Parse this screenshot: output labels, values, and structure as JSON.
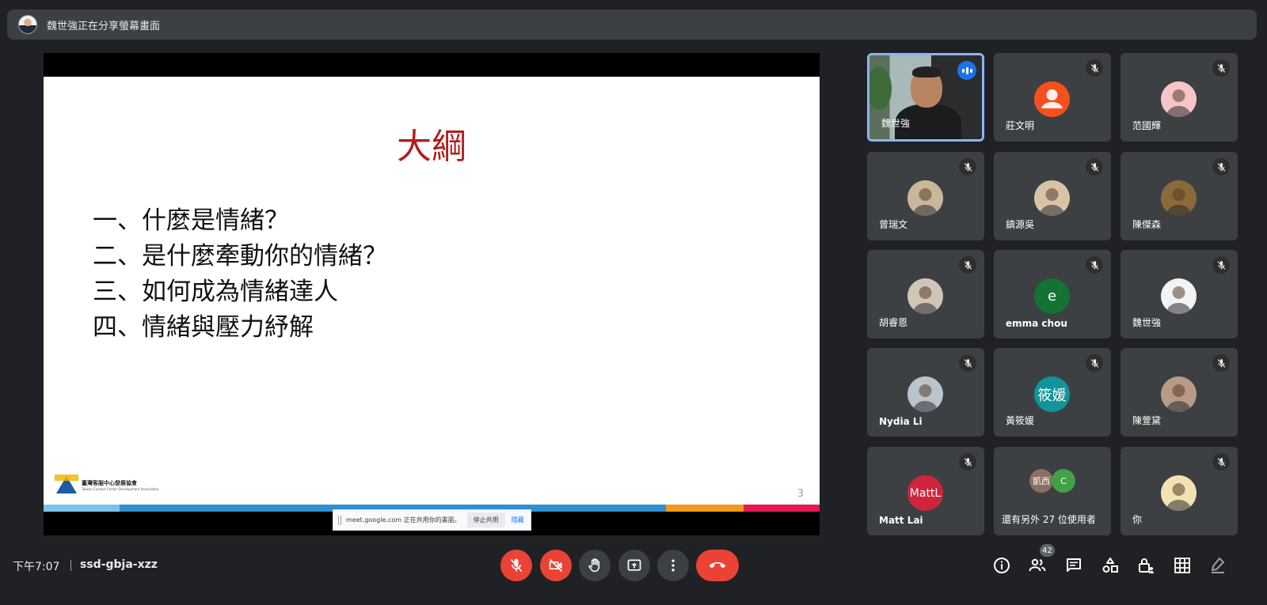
{
  "presenter_bar": {
    "text": "魏世強正在分享螢幕畫面"
  },
  "slide": {
    "title": "大綱",
    "items": [
      "一、什麼是情緒？",
      "二、是什麼牽動你的情緒？",
      "三、如何成為情緒達人",
      "四、情緒與壓力紓解"
    ],
    "logo_text": "臺灣客服中心發展協會",
    "logo_subtext": "Taiwan Contact Center Development Association",
    "page_number": "3",
    "stripe_colors": [
      "#7cc3ea",
      "#2f8fd0",
      "#f29a1c",
      "#e5194f"
    ]
  },
  "share_notice": {
    "text": "meet.google.com 正在共用你的畫面。",
    "stop_label": "停止共用",
    "hide_label": "隱藏"
  },
  "participants": [
    {
      "name": "魏世強",
      "type": "video",
      "speaking": true
    },
    {
      "name": "莊文明",
      "type": "default-avatar",
      "color": "#f4511e"
    },
    {
      "name": "范國輝",
      "type": "photo",
      "color": "#f6c5c9"
    },
    {
      "name": "曾瑞文",
      "type": "photo",
      "color": "#c9b79a"
    },
    {
      "name": "鎮源吳",
      "type": "photo",
      "color": "#d8c3a6"
    },
    {
      "name": "陳傑森",
      "type": "photo",
      "color": "#8a6a3b"
    },
    {
      "name": "胡睿恩",
      "type": "photo",
      "color": "#cfc6b8"
    },
    {
      "name": "emma chou",
      "type": "letter",
      "letter": "e",
      "color": "#137333",
      "bold": true
    },
    {
      "name": "魏世強",
      "type": "photo",
      "color": "#f1f3f4"
    },
    {
      "name": "Nydia Li",
      "type": "photo",
      "color": "#b9c4cc",
      "bold": true
    },
    {
      "name": "黃筱媛",
      "type": "letter",
      "letter": "筱媛",
      "color": "#12939a"
    },
    {
      "name": "陳萱黛",
      "type": "photo",
      "color": "#b79b86"
    },
    {
      "name": "Matt Lai",
      "type": "letter",
      "letter": "MattL",
      "color": "#d0243d",
      "bold": true
    },
    {
      "name": "還有另外 27 位使用者",
      "type": "more",
      "avatars": [
        {
          "label": "凱西",
          "color": "#8d6e63"
        },
        {
          "label": "C",
          "color": "#43a047"
        }
      ]
    },
    {
      "name": "你",
      "type": "photo",
      "color": "#f3e3b2"
    }
  ],
  "bottom_bar": {
    "time": "下午7:07",
    "meeting_code": "ssd-gbja-xzz",
    "people_count": "42"
  },
  "controls": {
    "mic": "mic-off-icon",
    "camera": "camera-off-icon",
    "raise_hand": "hand-icon",
    "present": "present-icon",
    "more": "more-options-icon",
    "leave": "end-call-icon"
  },
  "colors": {
    "background": "#202124",
    "tile": "#3c4043",
    "accent_red": "#ea4335",
    "active_border": "#8ab4f8",
    "slide_title": "#b21c1c"
  }
}
